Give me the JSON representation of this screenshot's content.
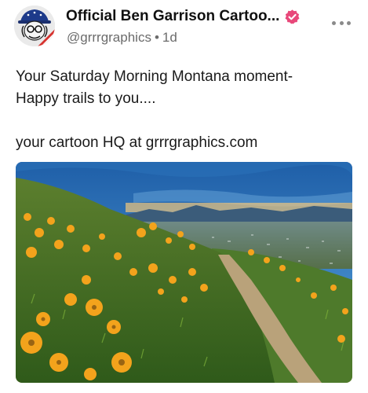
{
  "post": {
    "author_name": "Official  Ben Garrison Cartoo...",
    "handle": "@grrrgraphics",
    "separator": "•",
    "time": "1d",
    "text_line_1": "Your Saturday Morning Montana moment-",
    "text_line_2": "Happy trails to you....",
    "text_line_3": "your cartoon HQ at grrrgraphics.com"
  },
  "icons": {
    "verified": "verified-badge-icon",
    "more": "more-horizontal-icon"
  },
  "colors": {
    "verified_badge": "#e8487a",
    "meta_text": "#6b6b6b",
    "primary_text": "#111111"
  }
}
